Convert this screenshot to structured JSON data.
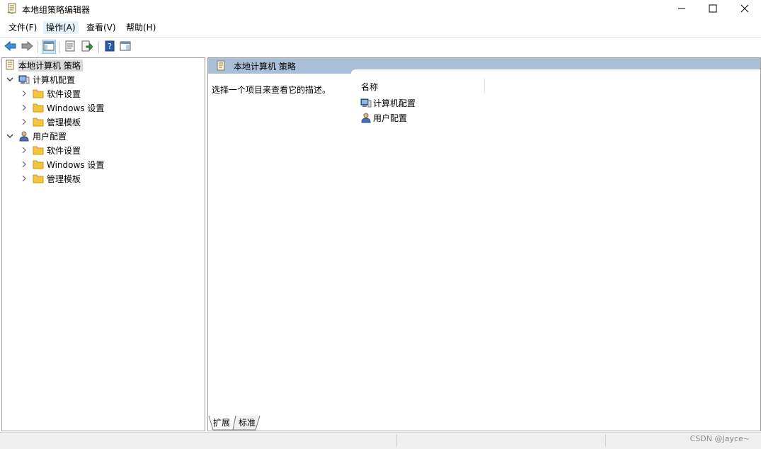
{
  "window": {
    "title": "本地组策略编辑器",
    "icon": "policy-document-icon"
  },
  "menu": [
    {
      "label": "文件(F)"
    },
    {
      "label": "操作(A)"
    },
    {
      "label": "查看(V)"
    },
    {
      "label": "帮助(H)"
    }
  ],
  "toolbar": {
    "buttons": [
      "back-icon",
      "forward-icon",
      "show-hide-console-tree-icon",
      "properties-icon",
      "export-list-icon",
      "help-icon",
      "show-action-pane-icon"
    ]
  },
  "tree": {
    "root": "本地计算机 策略",
    "computer": {
      "label": "计算机配置",
      "children": [
        "软件设置",
        "Windows 设置",
        "管理模板"
      ]
    },
    "user": {
      "label": "用户配置",
      "children": [
        "软件设置",
        "Windows 设置",
        "管理模板"
      ]
    }
  },
  "main": {
    "header": "本地计算机 策略",
    "description": "选择一个项目来查看它的描述。",
    "column_name": "名称",
    "items": [
      "计算机配置",
      "用户配置"
    ]
  },
  "tabs": [
    "扩展",
    "标准"
  ],
  "status": {
    "watermark": "CSDN @Jayce~"
  },
  "colors": {
    "header_bg": "#a9bfd7",
    "folder": "#f5c542",
    "selection": "#d9d9d9"
  }
}
